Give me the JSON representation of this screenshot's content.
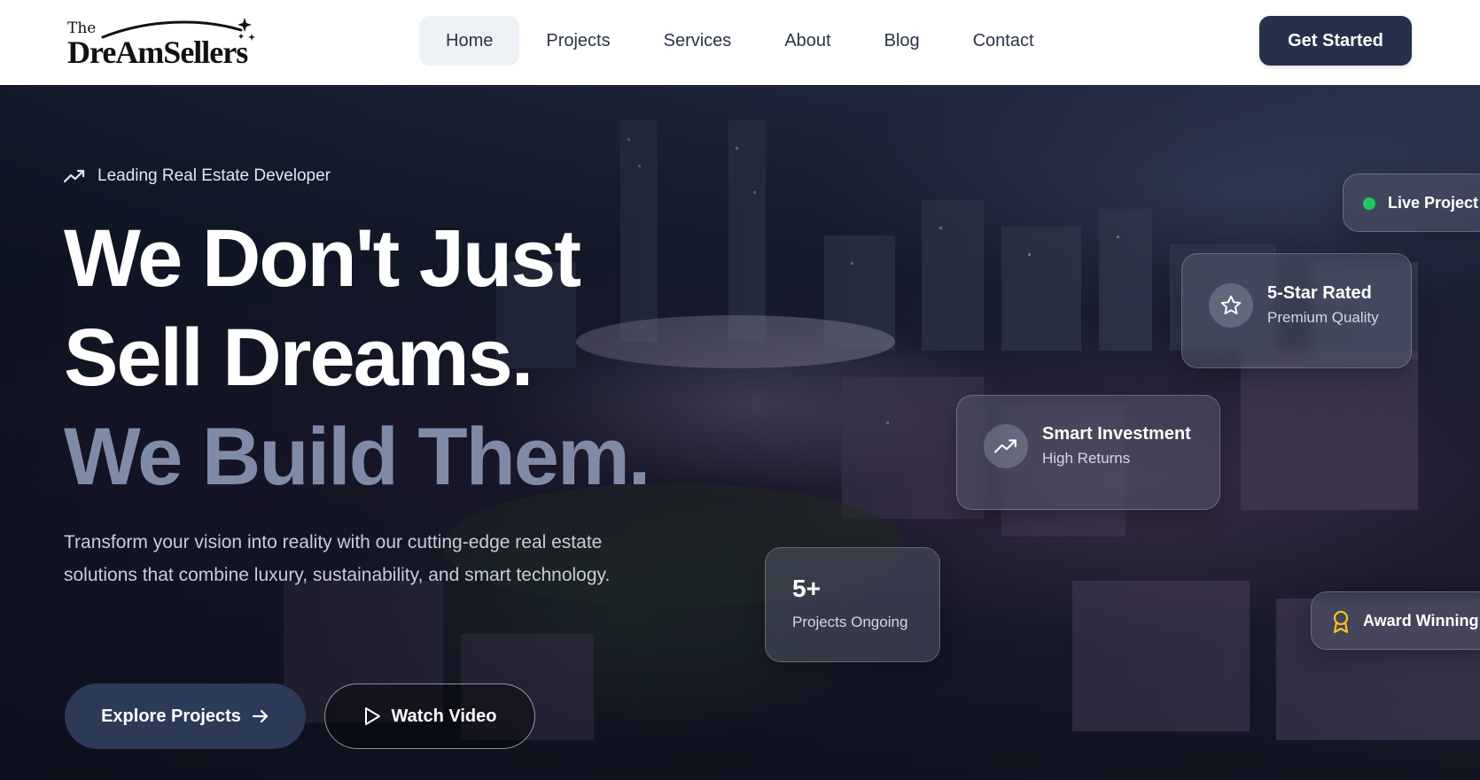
{
  "header": {
    "logo_top": "The",
    "logo_word": "DreAmSellers",
    "nav": [
      {
        "label": "Home",
        "active": true
      },
      {
        "label": "Projects"
      },
      {
        "label": "Services"
      },
      {
        "label": "About"
      },
      {
        "label": "Blog"
      },
      {
        "label": "Contact"
      }
    ],
    "cta_label": "Get Started"
  },
  "hero": {
    "eyebrow": "Leading Real Estate Developer",
    "headline_1": "We Don't Just",
    "headline_2": "Sell Dreams.",
    "headline_3": "We Build Them.",
    "description": "Transform your vision into reality with our cutting-edge real estate solutions that combine luxury, sustainability, and smart technology.",
    "primary_button": "Explore Projects",
    "secondary_button": "Watch Video"
  },
  "cards": {
    "live": {
      "label": "Live Project"
    },
    "rated": {
      "title": "5-Star Rated",
      "subtitle": "Premium Quality"
    },
    "smart": {
      "title": "Smart Investment",
      "subtitle": "High Returns"
    },
    "projects": {
      "title": "5+",
      "subtitle": "Projects Ongoing"
    },
    "award": {
      "label": "Award Winning"
    }
  },
  "colors": {
    "brand_dark": "#243149",
    "live_dot": "#22c55e",
    "award_gold": "#f5c518",
    "headline_muted": "#7f8ba6"
  },
  "icons": {
    "eyebrow": "trending-up-icon",
    "rated": "star-icon",
    "smart": "trending-up-icon",
    "primary_button": "arrow-right-icon",
    "secondary_button": "play-icon",
    "award": "award-icon"
  }
}
